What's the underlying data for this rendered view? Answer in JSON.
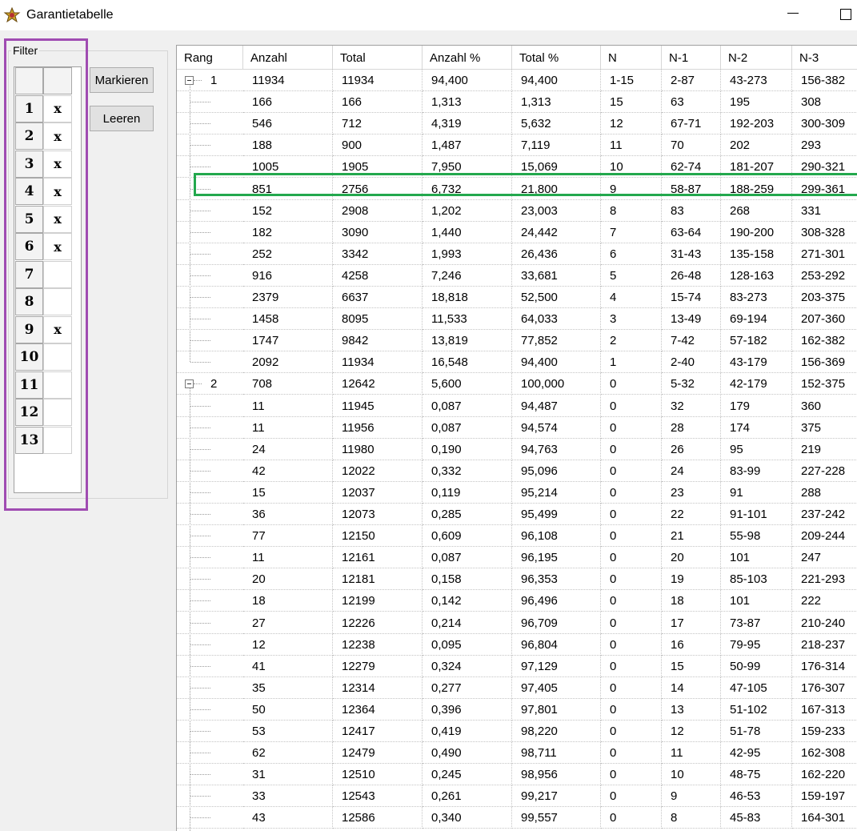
{
  "window": {
    "title": "Garantietabelle"
  },
  "filter": {
    "label": "Filter",
    "rows": [
      {
        "num": "1",
        "mark": "x"
      },
      {
        "num": "2",
        "mark": "x"
      },
      {
        "num": "3",
        "mark": "x"
      },
      {
        "num": "4",
        "mark": "x"
      },
      {
        "num": "5",
        "mark": "x"
      },
      {
        "num": "6",
        "mark": "x"
      },
      {
        "num": "7",
        "mark": ""
      },
      {
        "num": "8",
        "mark": ""
      },
      {
        "num": "9",
        "mark": "x"
      },
      {
        "num": "10",
        "mark": ""
      },
      {
        "num": "11",
        "mark": ""
      },
      {
        "num": "12",
        "mark": ""
      },
      {
        "num": "13",
        "mark": ""
      }
    ]
  },
  "buttons": {
    "markieren": "Markieren",
    "leeren": "Leeren"
  },
  "table": {
    "columns": [
      "Rang",
      "Anzahl",
      "Total",
      "Anzahl %",
      "Total %",
      "N",
      "N-1",
      "N-2",
      "N-3"
    ],
    "rows": [
      {
        "rang": "1",
        "group": true,
        "cells": [
          "11934",
          "11934",
          "94,400",
          "94,400",
          "1-15",
          "2-87",
          "43-273",
          "156-382"
        ]
      },
      {
        "rang": "",
        "cells": [
          "166",
          "166",
          "1,313",
          "1,313",
          "15",
          "63",
          "195",
          "308"
        ]
      },
      {
        "rang": "",
        "cells": [
          "546",
          "712",
          "4,319",
          "5,632",
          "12",
          "67-71",
          "192-203",
          "300-309"
        ]
      },
      {
        "rang": "",
        "cells": [
          "188",
          "900",
          "1,487",
          "7,119",
          "11",
          "70",
          "202",
          "293"
        ]
      },
      {
        "rang": "",
        "cells": [
          "1005",
          "1905",
          "7,950",
          "15,069",
          "10",
          "62-74",
          "181-207",
          "290-321"
        ]
      },
      {
        "rang": "",
        "cells": [
          "851",
          "2756",
          "6,732",
          "21,800",
          "9",
          "58-87",
          "188-259",
          "299-361"
        ]
      },
      {
        "rang": "",
        "cells": [
          "152",
          "2908",
          "1,202",
          "23,003",
          "8",
          "83",
          "268",
          "331"
        ]
      },
      {
        "rang": "",
        "cells": [
          "182",
          "3090",
          "1,440",
          "24,442",
          "7",
          "63-64",
          "190-200",
          "308-328"
        ]
      },
      {
        "rang": "",
        "cells": [
          "252",
          "3342",
          "1,993",
          "26,436",
          "6",
          "31-43",
          "135-158",
          "271-301"
        ]
      },
      {
        "rang": "",
        "cells": [
          "916",
          "4258",
          "7,246",
          "33,681",
          "5",
          "26-48",
          "128-163",
          "253-292"
        ]
      },
      {
        "rang": "",
        "cells": [
          "2379",
          "6637",
          "18,818",
          "52,500",
          "4",
          "15-74",
          "83-273",
          "203-375"
        ]
      },
      {
        "rang": "",
        "cells": [
          "1458",
          "8095",
          "11,533",
          "64,033",
          "3",
          "13-49",
          "69-194",
          "207-360"
        ]
      },
      {
        "rang": "",
        "cells": [
          "1747",
          "9842",
          "13,819",
          "77,852",
          "2",
          "7-42",
          "57-182",
          "162-382"
        ]
      },
      {
        "rang": "",
        "cells": [
          "2092",
          "11934",
          "16,548",
          "94,400",
          "1",
          "2-40",
          "43-179",
          "156-369"
        ]
      },
      {
        "rang": "2",
        "group": true,
        "cells": [
          "708",
          "12642",
          "5,600",
          "100,000",
          "0",
          "5-32",
          "42-179",
          "152-375"
        ]
      },
      {
        "rang": "",
        "cells": [
          "11",
          "11945",
          "0,087",
          "94,487",
          "0",
          "32",
          "179",
          "360"
        ]
      },
      {
        "rang": "",
        "cells": [
          "11",
          "11956",
          "0,087",
          "94,574",
          "0",
          "28",
          "174",
          "375"
        ]
      },
      {
        "rang": "",
        "cells": [
          "24",
          "11980",
          "0,190",
          "94,763",
          "0",
          "26",
          "95",
          "219"
        ]
      },
      {
        "rang": "",
        "cells": [
          "42",
          "12022",
          "0,332",
          "95,096",
          "0",
          "24",
          "83-99",
          "227-228"
        ]
      },
      {
        "rang": "",
        "cells": [
          "15",
          "12037",
          "0,119",
          "95,214",
          "0",
          "23",
          "91",
          "288"
        ]
      },
      {
        "rang": "",
        "cells": [
          "36",
          "12073",
          "0,285",
          "95,499",
          "0",
          "22",
          "91-101",
          "237-242"
        ]
      },
      {
        "rang": "",
        "cells": [
          "77",
          "12150",
          "0,609",
          "96,108",
          "0",
          "21",
          "55-98",
          "209-244"
        ]
      },
      {
        "rang": "",
        "cells": [
          "11",
          "12161",
          "0,087",
          "96,195",
          "0",
          "20",
          "101",
          "247"
        ]
      },
      {
        "rang": "",
        "cells": [
          "20",
          "12181",
          "0,158",
          "96,353",
          "0",
          "19",
          "85-103",
          "221-293"
        ]
      },
      {
        "rang": "",
        "cells": [
          "18",
          "12199",
          "0,142",
          "96,496",
          "0",
          "18",
          "101",
          "222"
        ]
      },
      {
        "rang": "",
        "cells": [
          "27",
          "12226",
          "0,214",
          "96,709",
          "0",
          "17",
          "73-87",
          "210-240"
        ]
      },
      {
        "rang": "",
        "cells": [
          "12",
          "12238",
          "0,095",
          "96,804",
          "0",
          "16",
          "79-95",
          "218-237"
        ]
      },
      {
        "rang": "",
        "cells": [
          "41",
          "12279",
          "0,324",
          "97,129",
          "0",
          "15",
          "50-99",
          "176-314"
        ]
      },
      {
        "rang": "",
        "cells": [
          "35",
          "12314",
          "0,277",
          "97,405",
          "0",
          "14",
          "47-105",
          "176-307"
        ]
      },
      {
        "rang": "",
        "cells": [
          "50",
          "12364",
          "0,396",
          "97,801",
          "0",
          "13",
          "51-102",
          "167-313"
        ]
      },
      {
        "rang": "",
        "cells": [
          "53",
          "12417",
          "0,419",
          "98,220",
          "0",
          "12",
          "51-78",
          "159-233"
        ]
      },
      {
        "rang": "",
        "cells": [
          "62",
          "12479",
          "0,490",
          "98,711",
          "0",
          "11",
          "42-95",
          "162-308"
        ]
      },
      {
        "rang": "",
        "cells": [
          "31",
          "12510",
          "0,245",
          "98,956",
          "0",
          "10",
          "48-75",
          "162-220"
        ]
      },
      {
        "rang": "",
        "cells": [
          "33",
          "12543",
          "0,261",
          "99,217",
          "0",
          "9",
          "46-53",
          "159-197"
        ]
      },
      {
        "rang": "",
        "cells": [
          "43",
          "12586",
          "0,340",
          "99,557",
          "0",
          "8",
          "45-83",
          "164-301"
        ]
      }
    ]
  },
  "highlight": {
    "row_index": 5,
    "color": "#23a84d"
  },
  "colors": {
    "filter_outline": "#a04cb2",
    "highlight_outline": "#23a84d"
  }
}
